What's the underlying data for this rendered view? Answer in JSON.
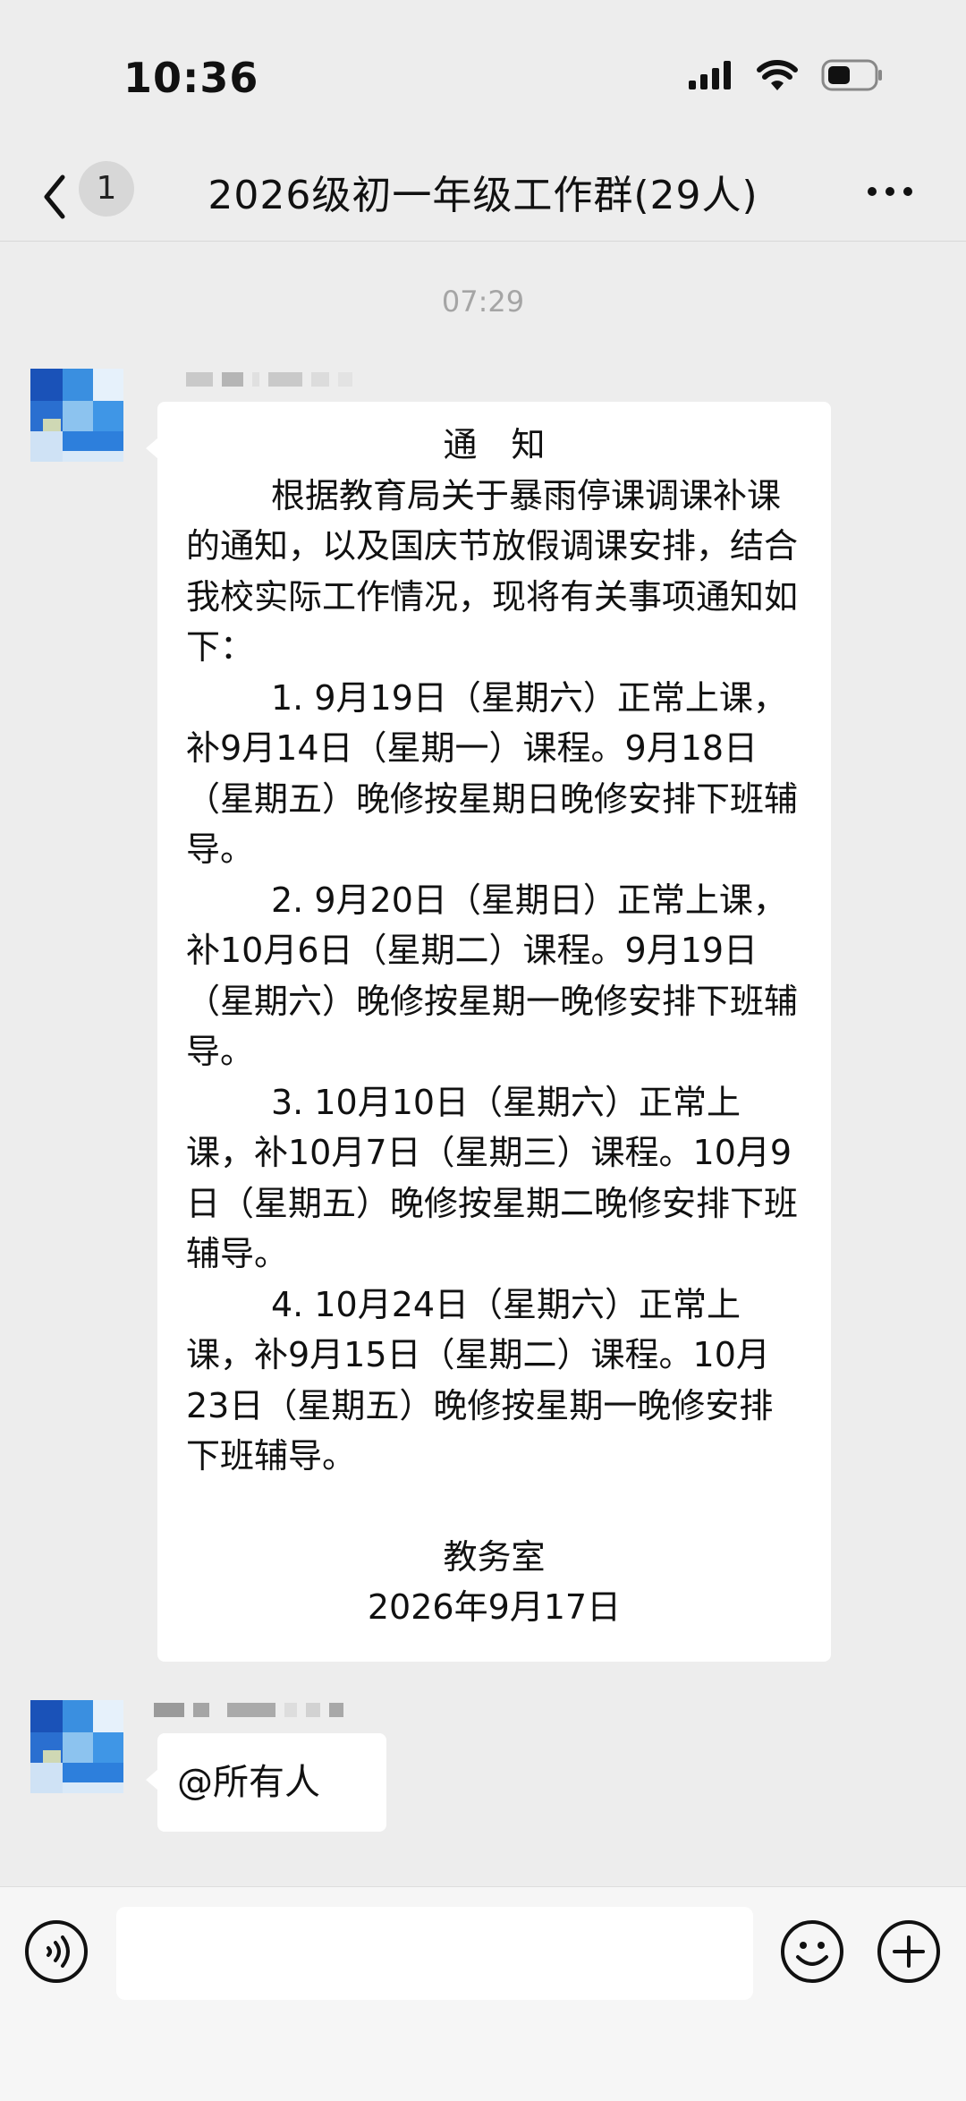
{
  "status_bar": {
    "time": "10:36",
    "icons": [
      "signal-icon",
      "wifi-icon",
      "battery-icon"
    ]
  },
  "nav": {
    "unread_count": "1",
    "title": "2026级初一年级工作群(29人)"
  },
  "chat": {
    "timestamp": "07:29",
    "messages": [
      {
        "lines": [
          "通　知",
          "根据教育局关于暴雨停课调课补课的通知，以及国庆节放假调课安排，结合我校实际工作情况，现将有关事项通知如下：",
          "1. 9月19日（星期六）正常上课，补9月14日（星期一）课程。9月18日（星期五）晚修按星期日晚修安排下班辅导。",
          "2. 9月20日（星期日）正常上课，补10月6日（星期二）课程。9月19日（星期六）晚修按星期一晚修安排下班辅导。",
          "3. 10月10日（星期六）正常上课，补10月7日（星期三）课程。10月9日（星期五）晚修按星期二晚修安排下班辅导。",
          "4. 10月24日（星期六）正常上课，补9月15日（星期二）课程。10月23日（星期五）晚修按星期一晚修安排下班辅导。",
          "教务室",
          "2026年9月17日"
        ]
      },
      {
        "text": "@所有人"
      }
    ]
  },
  "input": {
    "placeholder": "",
    "icons": [
      "voice-icon",
      "emoji-icon",
      "plus-icon"
    ]
  },
  "colors": {
    "background": "#ededed",
    "bubble": "#ffffff",
    "timestamp": "#a5a5a5",
    "avatar_blue": "#1a6fd6"
  }
}
